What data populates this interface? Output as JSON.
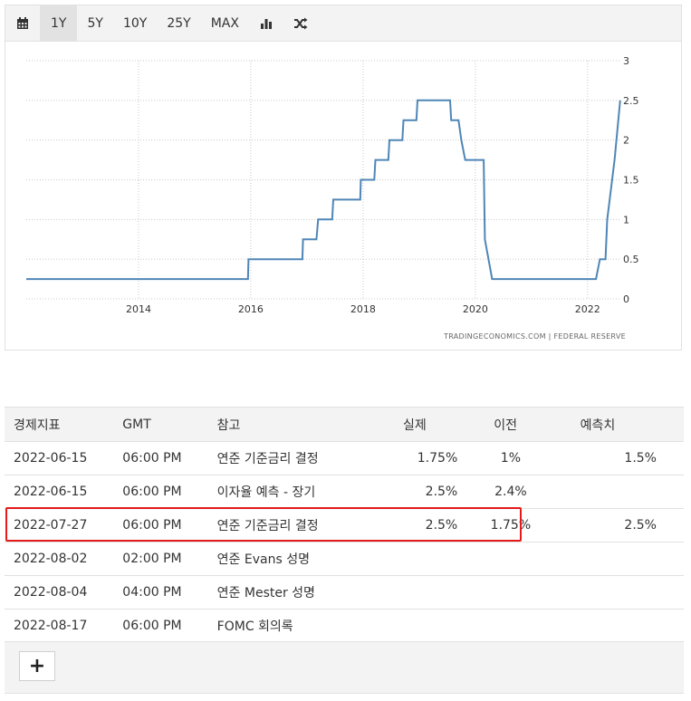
{
  "toolbar": {
    "calendar_icon": "calendar-icon",
    "ranges": [
      "1Y",
      "5Y",
      "10Y",
      "25Y",
      "MAX"
    ],
    "active_range": "1Y",
    "bar_icon": "bar-chart-icon",
    "shuffle_icon": "shuffle-icon"
  },
  "chart_data": {
    "type": "line",
    "line_color": "#4f86b6",
    "x_ticks": [
      "2014",
      "2016",
      "2018",
      "2020",
      "2022"
    ],
    "y_ticks": [
      "0",
      "0.5",
      "1",
      "1.5",
      "2",
      "2.5",
      "3"
    ],
    "ylim": [
      0,
      3
    ],
    "xlim": [
      2012.0,
      2022.6
    ],
    "grid": true,
    "source": "TRADINGECONOMICS.COM  |  FEDERAL RESERVE",
    "series": [
      {
        "points": [
          [
            2012.0,
            0.25
          ],
          [
            2015.95,
            0.25
          ],
          [
            2015.96,
            0.5
          ],
          [
            2016.92,
            0.5
          ],
          [
            2016.93,
            0.75
          ],
          [
            2017.17,
            0.75
          ],
          [
            2017.2,
            1.0
          ],
          [
            2017.45,
            1.0
          ],
          [
            2017.47,
            1.25
          ],
          [
            2017.95,
            1.25
          ],
          [
            2017.96,
            1.5
          ],
          [
            2018.2,
            1.5
          ],
          [
            2018.22,
            1.75
          ],
          [
            2018.45,
            1.75
          ],
          [
            2018.47,
            2.0
          ],
          [
            2018.7,
            2.0
          ],
          [
            2018.72,
            2.25
          ],
          [
            2018.95,
            2.25
          ],
          [
            2018.97,
            2.5
          ],
          [
            2019.55,
            2.5
          ],
          [
            2019.57,
            2.25
          ],
          [
            2019.7,
            2.25
          ],
          [
            2019.75,
            2.0
          ],
          [
            2019.82,
            1.75
          ],
          [
            2020.15,
            1.75
          ],
          [
            2020.17,
            0.75
          ],
          [
            2020.3,
            0.25
          ],
          [
            2022.15,
            0.25
          ],
          [
            2022.22,
            0.5
          ],
          [
            2022.32,
            0.5
          ],
          [
            2022.35,
            1.0
          ],
          [
            2022.48,
            1.75
          ],
          [
            2022.58,
            2.5
          ]
        ]
      }
    ]
  },
  "table": {
    "headers": [
      "경제지표",
      "GMT",
      "참고",
      "실제",
      "이전",
      "예측치"
    ],
    "rows": [
      [
        "2022-06-15",
        "06:00 PM",
        "연준 기준금리 결정",
        "1.75%",
        "1%",
        "1.5%"
      ],
      [
        "2022-06-15",
        "06:00 PM",
        "이자율 예측 - 장기",
        "2.5%",
        "2.4%",
        ""
      ],
      [
        "2022-07-27",
        "06:00 PM",
        "연준 기준금리 결정",
        "2.5%",
        "1.75%",
        "2.5%"
      ],
      [
        "2022-08-02",
        "02:00 PM",
        "연준 Evans 성명",
        "",
        "",
        ""
      ],
      [
        "2022-08-04",
        "04:00 PM",
        "연준 Mester 성명",
        "",
        "",
        ""
      ],
      [
        "2022-08-17",
        "06:00 PM",
        "FOMC 회의록",
        "",
        "",
        ""
      ]
    ],
    "highlighted_row": 2,
    "highlight_color": "#e31b1b"
  },
  "footer": {
    "add_label": "+"
  }
}
